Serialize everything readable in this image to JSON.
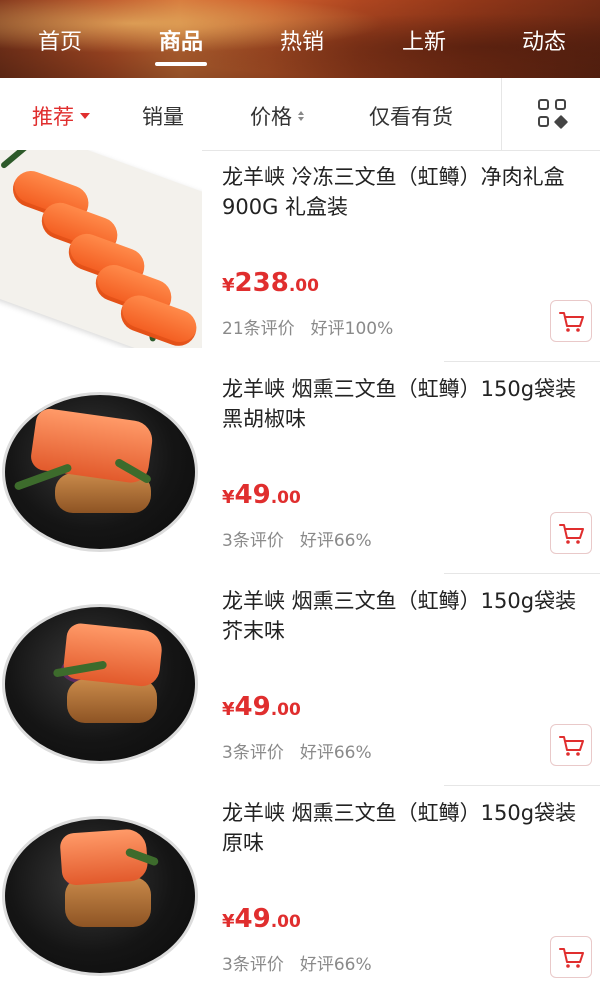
{
  "top_tabs": [
    {
      "label": "首页"
    },
    {
      "label": "商品",
      "active": true
    },
    {
      "label": "热销"
    },
    {
      "label": "上新"
    },
    {
      "label": "动态"
    }
  ],
  "filters": {
    "recommend": "推荐",
    "sales": "销量",
    "price": "价格",
    "in_stock": "仅看有货",
    "layout_toggle_icon": "grid-layout-icon"
  },
  "products": [
    {
      "title": "龙羊峡 冷冻三文鱼（虹鳟）净肉礼盒 900G 礼盒装",
      "currency": "¥",
      "price_int": "238",
      "price_dec": ".00",
      "reviews": "21条评价",
      "good_rate": "好评100%",
      "image": "salmon-slices-tray"
    },
    {
      "title": "龙羊峡 烟熏三文鱼（虹鳟）150g袋装 黑胡椒味",
      "currency": "¥",
      "price_int": "49",
      "price_dec": ".00",
      "reviews": "3条评价",
      "good_rate": "好评66%",
      "image": "smoked-salmon-plate"
    },
    {
      "title": "龙羊峡 烟熏三文鱼（虹鳟）150g袋装 芥末味",
      "currency": "¥",
      "price_int": "49",
      "price_dec": ".00",
      "reviews": "3条评价",
      "good_rate": "好评66%",
      "image": "smoked-salmon-plate"
    },
    {
      "title": "龙羊峡 烟熏三文鱼（虹鳟）150g袋装 原味",
      "currency": "¥",
      "price_int": "49",
      "price_dec": ".00",
      "reviews": "3条评价",
      "good_rate": "好评66%",
      "image": "smoked-salmon-plate"
    }
  ],
  "colors": {
    "accent": "#e02e2e",
    "muted": "#8a8a8a"
  }
}
